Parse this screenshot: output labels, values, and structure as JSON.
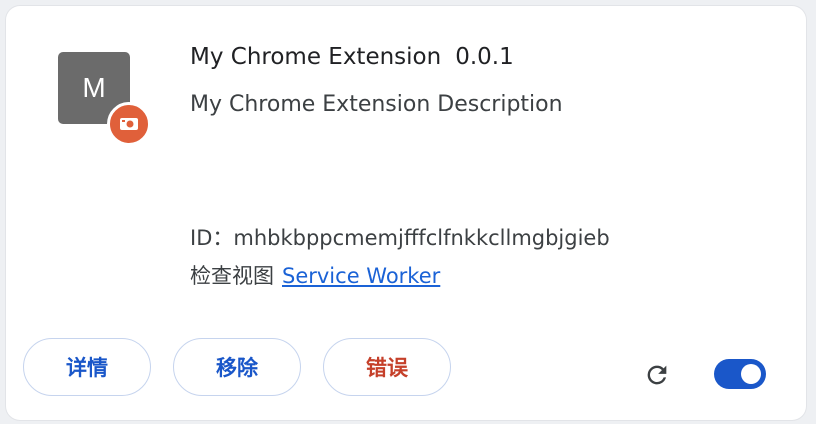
{
  "extension": {
    "icon_letter": "M",
    "icon_badge": "camera-icon",
    "name": "My Chrome Extension",
    "version": "0.0.1",
    "description": "My Chrome Extension Description",
    "id_label": "ID：",
    "id_value": "mhbkbppcmemjfffclfnkkcllmgbjgieb",
    "inspect_label": "检查视图",
    "inspect_link": "Service Worker"
  },
  "actions": {
    "details": "详情",
    "remove": "移除",
    "errors": "错误",
    "reload_icon": "reload-icon",
    "enabled": true
  },
  "colors": {
    "accent": "#1a57c9",
    "error": "#c5402a",
    "badge": "#e0603a",
    "icon_bg": "#6b6b6b"
  }
}
